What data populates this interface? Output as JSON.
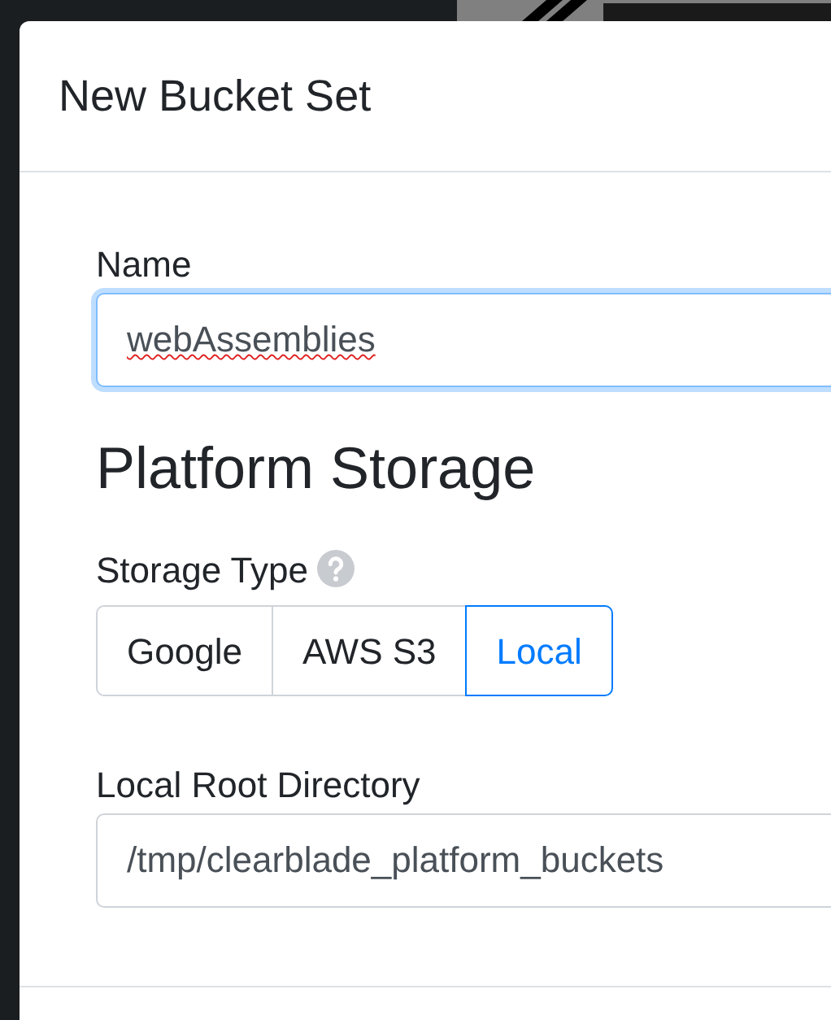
{
  "modal": {
    "title": "New Bucket Set"
  },
  "name_field": {
    "label": "Name",
    "value": "webAssemblies",
    "focused": true,
    "misspelled": true
  },
  "section_heading": "Platform Storage",
  "storage_type": {
    "label": "Storage Type",
    "options": [
      {
        "label": "Google",
        "selected": false
      },
      {
        "label": "AWS S3",
        "selected": false
      },
      {
        "label": "Local",
        "selected": true
      }
    ]
  },
  "root_field": {
    "label": "Local Root Directory",
    "value": "/tmp/clearblade_platform_buckets",
    "focused": false,
    "misspelled": false
  }
}
